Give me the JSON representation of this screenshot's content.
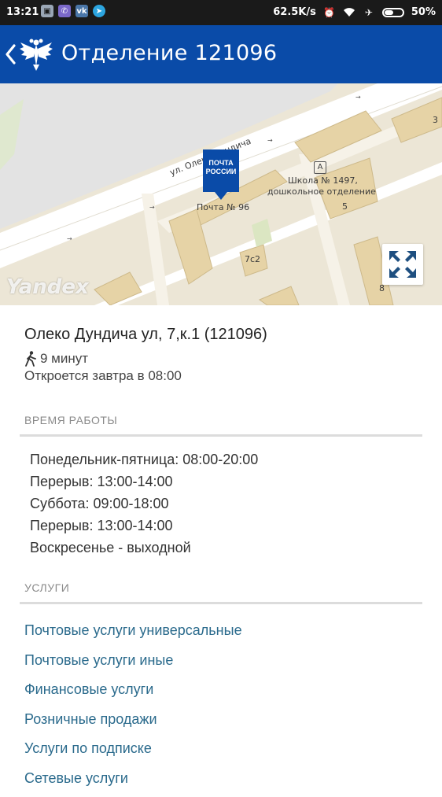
{
  "status_bar": {
    "time": "13:21",
    "speed": "62.5K/s",
    "battery": "50%",
    "battery_level": 0.5,
    "apps": [
      "gallery-icon",
      "viber-icon",
      "vk-icon",
      "telegram-icon"
    ]
  },
  "header": {
    "title": "Отделение 121096",
    "color": "#0a4ba8"
  },
  "map": {
    "watermark": "Yandex",
    "street_label": "ул. Олеко Дундича",
    "pin_text_line1": "ПОЧТА",
    "pin_text_line2": "РОССИИ",
    "post_label": "Почта № 96",
    "school_label_1": "Школа № 1497,",
    "school_label_2": "дошкольное отделение",
    "building_5": "5",
    "building_7c2": "7с2",
    "building_3": "3",
    "building_8": "8"
  },
  "branch": {
    "address": "Олеко Дундича ул, 7,к.1 (121096)",
    "walk_time": "9 минут",
    "opens": "Откроется завтра в 08:00"
  },
  "hours": {
    "title": "ВРЕМЯ РАБОТЫ",
    "rows": [
      "Понедельник-пятница: 08:00-20:00",
      "Перерыв: 13:00-14:00",
      "Суббота: 09:00-18:00",
      "Перерыв: 13:00-14:00",
      "Воскресенье - выходной"
    ]
  },
  "services": {
    "title": "УСЛУГИ",
    "items": [
      "Почтовые услуги универсальные",
      "Почтовые услуги иные",
      "Финансовые услуги",
      "Розничные продажи",
      "Услуги по подписке",
      "Сетевые услуги"
    ]
  }
}
